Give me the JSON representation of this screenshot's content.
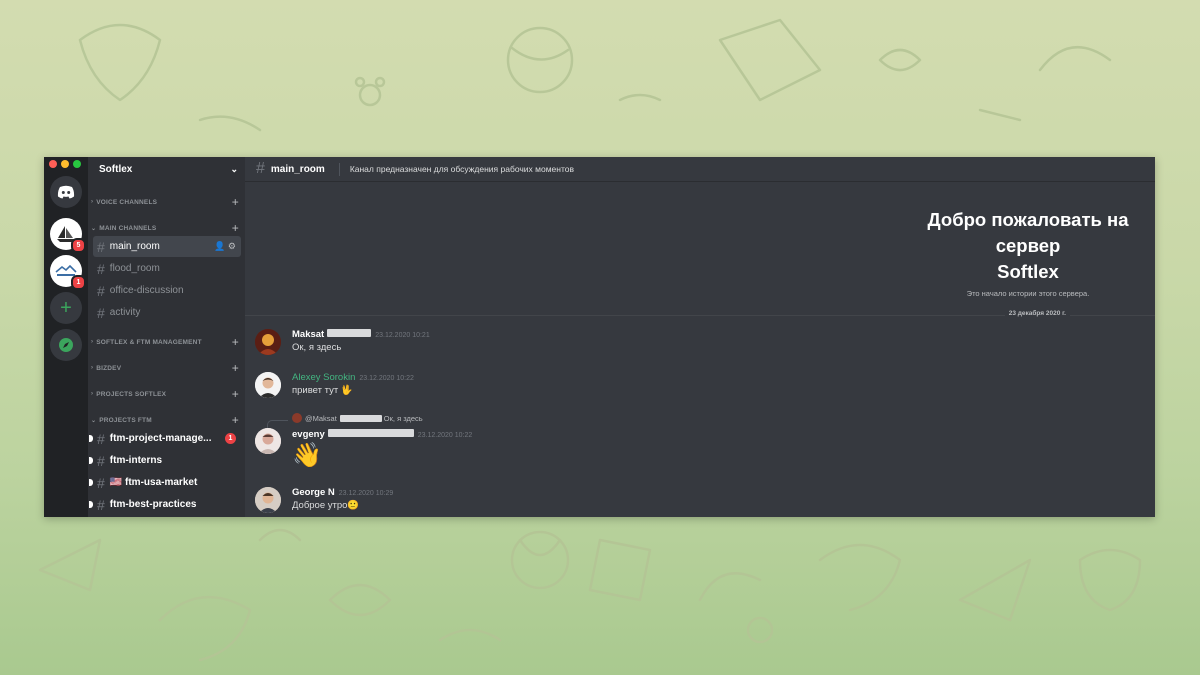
{
  "server": {
    "name": "Softlex"
  },
  "rail": {
    "badges": [
      "5",
      "1"
    ]
  },
  "categories": {
    "voice": "VOICE CHANNELS",
    "main": "MAIN CHANNELS",
    "softlex_ftm": "SOFTLEX & FTM MANAGEMENT",
    "bizdev": "BIZDEV",
    "projects_softlex": "PROJECTS SOFTLEX",
    "projects_ftm": "PROJECTS FTM"
  },
  "main_channels": [
    "main_room",
    "flood_room",
    "office-discussion",
    "activity"
  ],
  "ftm_channels": [
    {
      "name": "ftm-project-manage...",
      "badge": "1"
    },
    {
      "name": "ftm-interns"
    },
    {
      "name": "🇺🇸 ftm-usa-market"
    },
    {
      "name": "ftm-best-practices"
    }
  ],
  "channel_header": {
    "name": "main_room",
    "topic": "Канал предназначен для обсуждения рабочих моментов"
  },
  "welcome": {
    "title_line1": "Добро пожаловать на",
    "title_line2": "сервер",
    "title_line3": "Softlex",
    "subtitle": "Это начало истории этого сервера."
  },
  "date_divider": "23 декабря 2020 г.",
  "messages": [
    {
      "author": "Maksat",
      "timestamp": "23.12.2020 10:21",
      "text": "Ок, я здесь"
    },
    {
      "author": "Alexey Sorokin",
      "timestamp": "23.12.2020 10:22",
      "text": "привет тут 🖖"
    },
    {
      "reply": "@Maksat",
      "reply_text": "Ок, я здесь",
      "author": "evgeny",
      "timestamp": "23.12.2020 10:22",
      "text": "👋"
    },
    {
      "author": "George N",
      "timestamp": "23.12.2020 10:29",
      "text": "Доброе утро🙂"
    }
  ],
  "colors": {
    "rail": "#202225",
    "sidebar": "#2f3136",
    "main": "#36393f",
    "accent_green": "#43b581",
    "badge_red": "#ed4245"
  }
}
